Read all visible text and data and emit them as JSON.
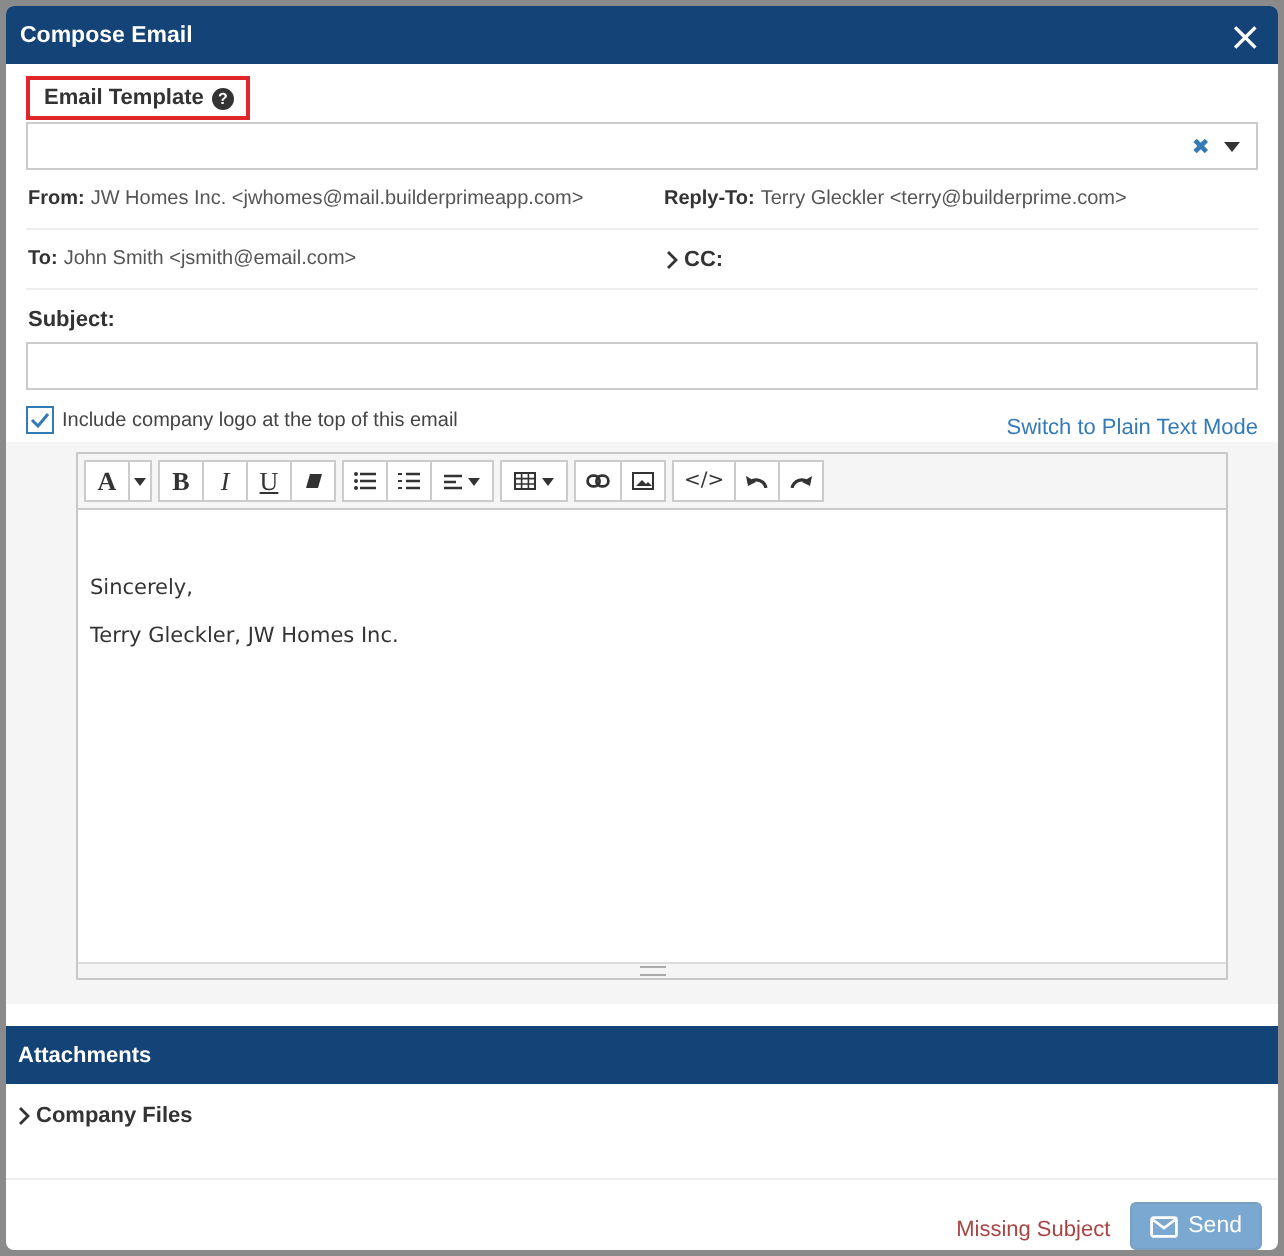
{
  "dialog": {
    "title": "Compose Email",
    "close": "×"
  },
  "template": {
    "label": "Email Template",
    "highlighted": true,
    "help": "?",
    "clear": "✖"
  },
  "from": {
    "label": "From:",
    "value": "JW Homes Inc. <jwhomes@mail.builderprimeapp.com>"
  },
  "reply_to": {
    "label": "Reply-To:",
    "value": "Terry Gleckler <terry@builderprime.com>"
  },
  "to": {
    "label": "To:",
    "value": "John Smith <jsmith@email.com>"
  },
  "cc": {
    "label": "CC:",
    "expanded": false
  },
  "subject": {
    "label": "Subject:"
  },
  "include_logo": {
    "label": "Include company logo at the top of this email",
    "checked": true
  },
  "plain_text_link": "Switch to Plain Text Mode",
  "toolbar_labels": [
    "A",
    "B",
    "I",
    "U",
    "</>"
  ],
  "body": [
    "Sincerely,",
    "Terry Gleckler, JW Homes Inc."
  ],
  "attachments": {
    "title": "Attachments",
    "folders": [
      {
        "label": "Company Files",
        "expanded": false
      }
    ]
  },
  "footer": {
    "warning": "Missing Subject",
    "send": {
      "label": "Send",
      "disabled": true
    }
  }
}
